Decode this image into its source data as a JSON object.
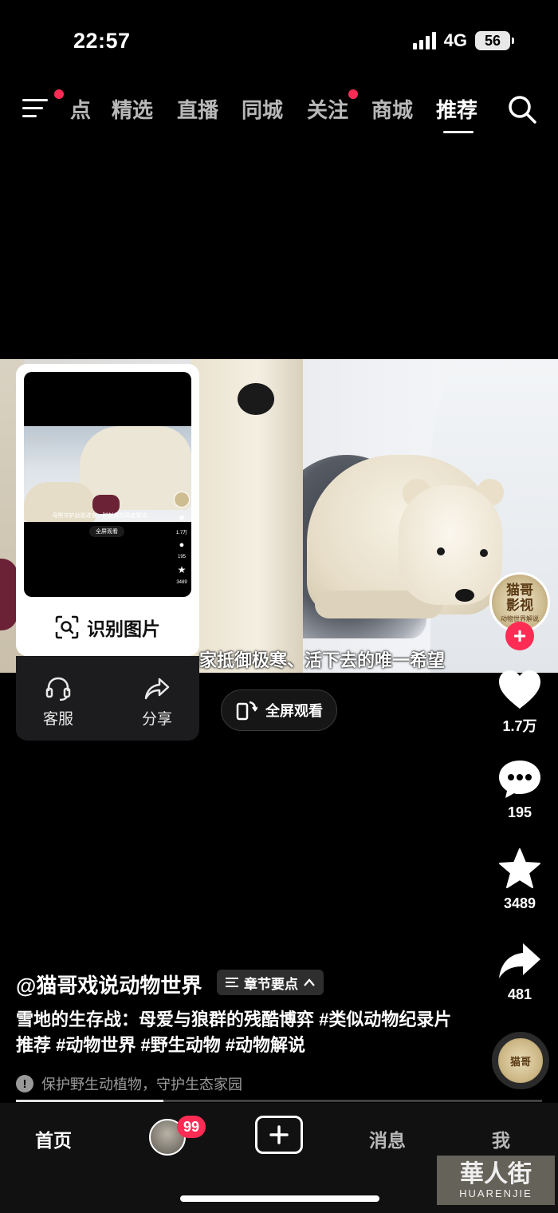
{
  "status": {
    "time": "22:57",
    "network": "4G",
    "battery": "56"
  },
  "topnav": {
    "tabs": [
      {
        "label": "点",
        "active": false
      },
      {
        "label": "精选",
        "active": false
      },
      {
        "label": "直播",
        "active": false
      },
      {
        "label": "同城",
        "active": false
      },
      {
        "label": "关注",
        "active": false
      },
      {
        "label": "商城",
        "active": false
      },
      {
        "label": "推荐",
        "active": true
      }
    ]
  },
  "video": {
    "subtitle": "这顿食物是它们一家抵御极寒、活下去的唯一希望",
    "fullscreen_label": "全屏观看"
  },
  "creator_avatar": {
    "line1": "猫哥",
    "line2": "影视",
    "tagline": "动物世界解说"
  },
  "actions": {
    "likes": "1.7万",
    "comments": "195",
    "favorites": "3489",
    "shares": "481"
  },
  "popup": {
    "recognize_label": "识别图片",
    "thumb_caption": "母熊守护幼崽进食，时刻保持高度警戒",
    "thumb_label": "猫哥影视",
    "thumb_fullscreen": "全屏观看",
    "thumb_counts": {
      "likes": "1.7万",
      "comments": "195",
      "favorites": "3489"
    }
  },
  "panel": {
    "service_label": "客服",
    "share_label": "分享"
  },
  "info": {
    "author": "@猫哥戏说动物世界",
    "chapter_label": "章节要点",
    "description": "雪地的生存战：母爱与狼群的残酷博弈 #类似动物纪录片推荐 #动物世界 #野生动物 #动物解说",
    "notice": "保护野生动植物，守护生态家园",
    "progress": 0.28
  },
  "music_disc": {
    "label": "猫哥"
  },
  "tabbar": {
    "home": "首页",
    "badge": "99",
    "messages": "消息",
    "me": "我"
  },
  "watermark": {
    "line1": "華人街",
    "line2": "HUARENJIE"
  },
  "colors": {
    "accent": "#fe2c55",
    "background": "#000000"
  }
}
